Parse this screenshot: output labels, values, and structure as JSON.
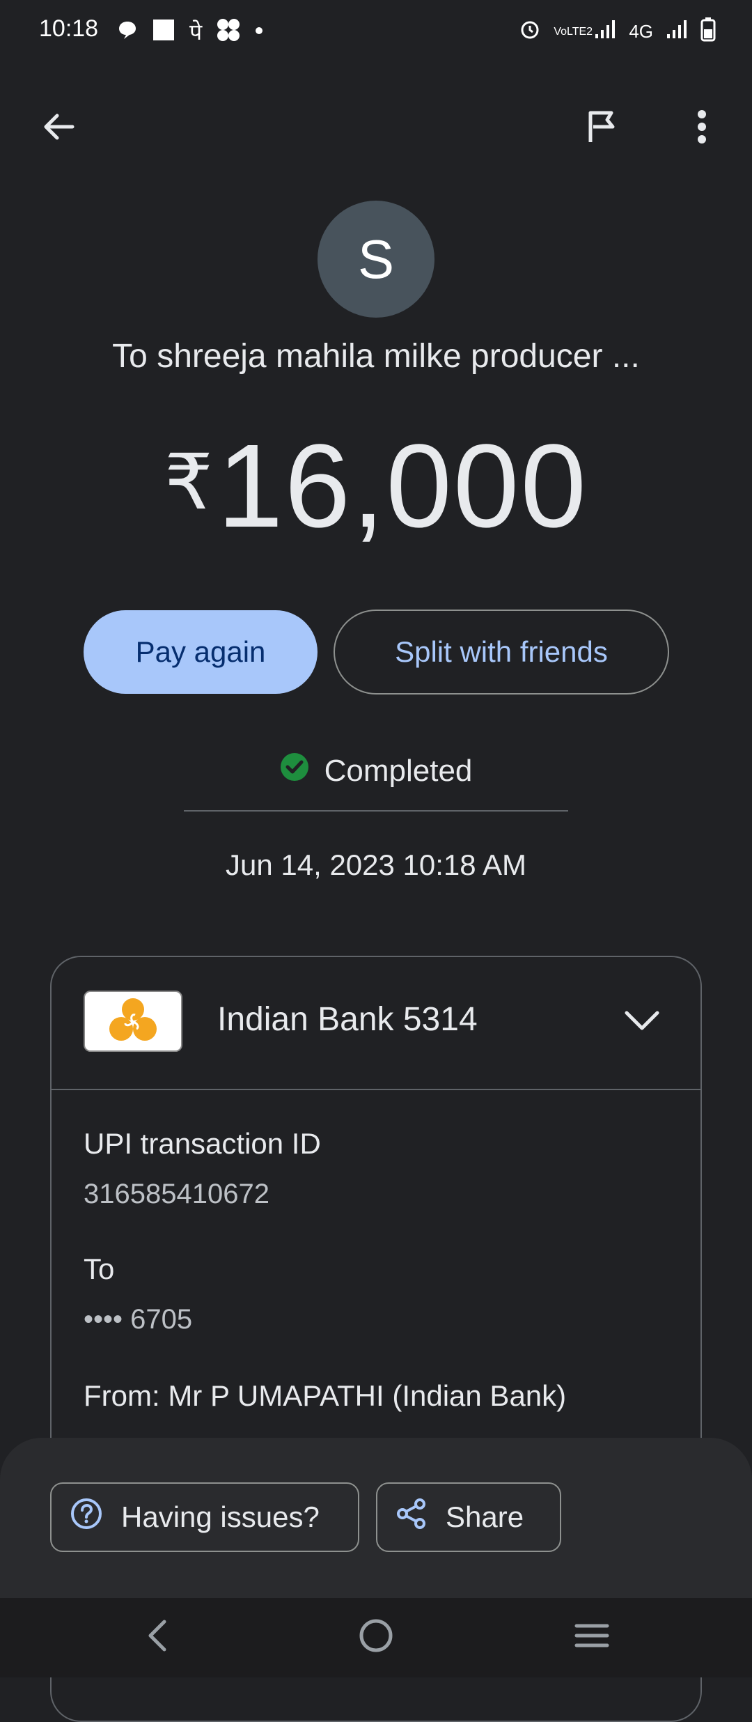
{
  "status_bar": {
    "time": "10:18",
    "left_icons": [
      "chat-bubble-icon",
      "square-icon",
      "devanagari-pe-icon",
      "pinwheel-icon",
      "dot-icon"
    ],
    "right_text_volte": "VoLTE2",
    "right_text_network": "4G"
  },
  "top_bar": {
    "back_icon": "arrow-left-icon",
    "flag_icon": "flag-icon",
    "more_icon": "more-vert-icon"
  },
  "recipient": {
    "initial": "S",
    "name": "To shreeja mahila milke producer ..."
  },
  "amount": {
    "currency": "₹",
    "value": "16,000"
  },
  "actions": {
    "pay_again": "Pay again",
    "split": "Split with friends"
  },
  "status": {
    "label": "Completed",
    "color": "#1e8e3e"
  },
  "date": "Jun 14, 2023 10:18 AM",
  "details": {
    "bank_name": "Indian Bank 5314",
    "upi_label": "UPI transaction ID",
    "upi_value": "316585410672",
    "to_label": "To",
    "to_value": "•••• 6705",
    "from_label": "From: Mr P UMAPATHI (Indian Bank)"
  },
  "bottom_sheet": {
    "issues": "Having issues?",
    "share": "Share"
  },
  "colors": {
    "background": "#202124",
    "accent": "#a8c7fa",
    "avatar": "#48535c",
    "bank_logo": "#f4a620"
  }
}
